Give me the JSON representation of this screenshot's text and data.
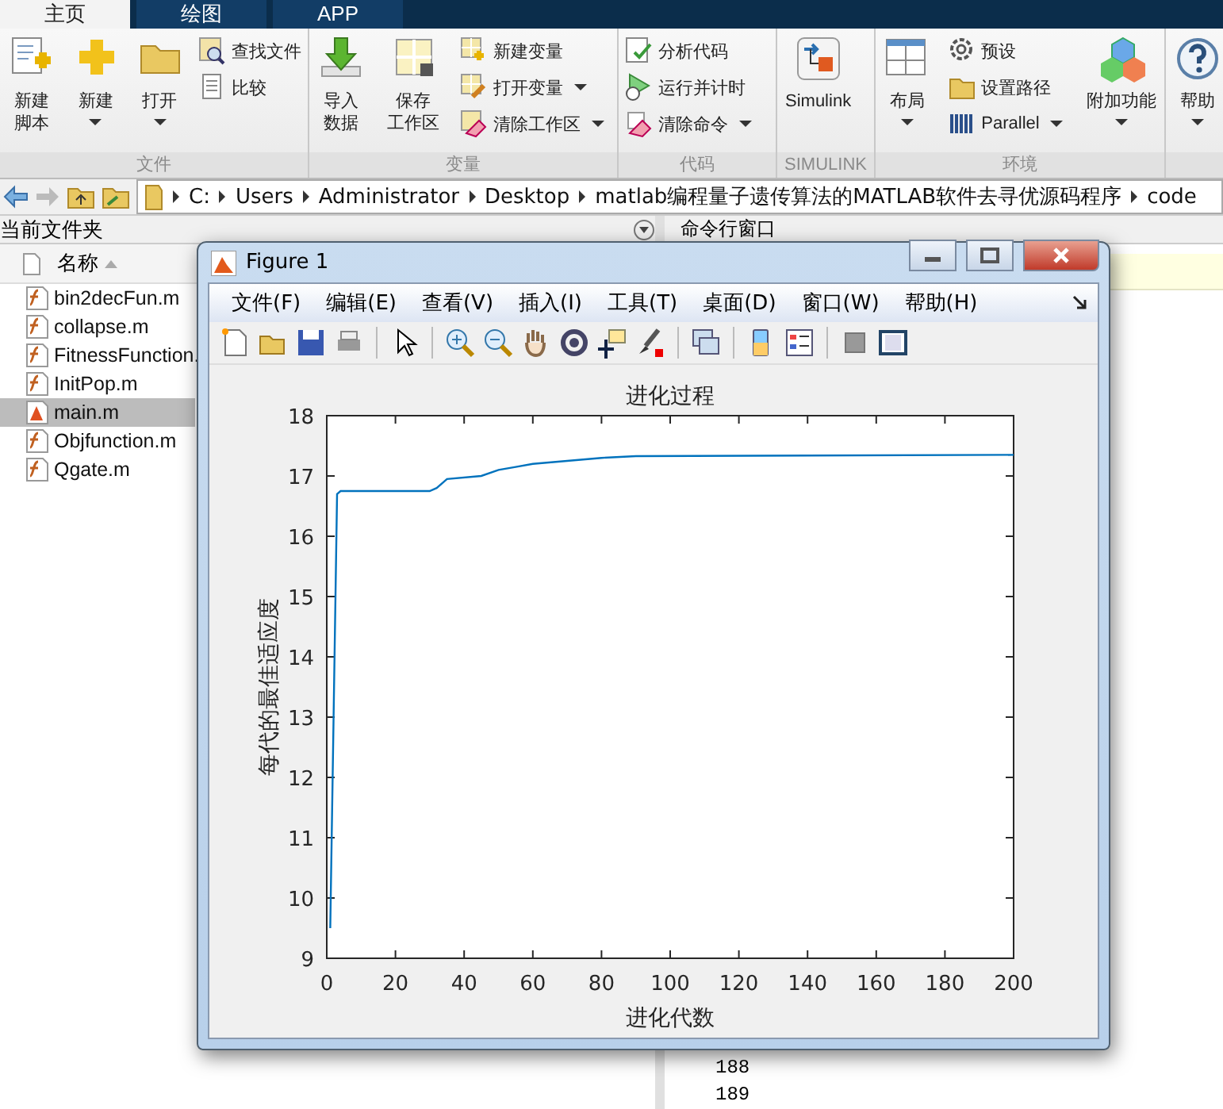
{
  "ribbon": {
    "tabs": [
      {
        "label": "主页",
        "selected": true
      },
      {
        "label": "绘图",
        "selected": false
      },
      {
        "label": "APP",
        "selected": false
      }
    ],
    "groups": [
      {
        "label": "文件",
        "items": [
          {
            "kind": "large",
            "lines": [
              "新建",
              "脚本"
            ],
            "dropdown": false
          },
          {
            "kind": "large",
            "lines": [
              "新建"
            ],
            "dropdown": true
          },
          {
            "kind": "large",
            "lines": [
              "打开"
            ],
            "dropdown": true
          },
          {
            "kind": "small",
            "label": "查找文件",
            "dropdown": false
          },
          {
            "kind": "small",
            "label": "比较",
            "dropdown": false
          }
        ]
      },
      {
        "label": "变量",
        "items": [
          {
            "kind": "large",
            "lines": [
              "导入",
              "数据"
            ],
            "dropdown": false
          },
          {
            "kind": "large",
            "lines": [
              "保存",
              "工作区"
            ],
            "dropdown": false
          },
          {
            "kind": "small",
            "label": "新建变量",
            "dropdown": false
          },
          {
            "kind": "small",
            "label": "打开变量",
            "dropdown": true
          },
          {
            "kind": "small",
            "label": "清除工作区",
            "dropdown": true
          }
        ]
      },
      {
        "label": "代码",
        "items": [
          {
            "kind": "small",
            "label": "分析代码",
            "dropdown": false
          },
          {
            "kind": "small",
            "label": "运行并计时",
            "dropdown": false
          },
          {
            "kind": "small",
            "label": "清除命令",
            "dropdown": true
          }
        ]
      },
      {
        "label": "SIMULINK",
        "items": [
          {
            "kind": "large",
            "lines": [
              "Simulink"
            ],
            "dropdown": false
          }
        ]
      },
      {
        "label": "环境",
        "items": [
          {
            "kind": "large",
            "lines": [
              "布局"
            ],
            "dropdown": true
          },
          {
            "kind": "small",
            "label": "预设",
            "dropdown": false
          },
          {
            "kind": "small",
            "label": "设置路径",
            "dropdown": false
          },
          {
            "kind": "small",
            "label": "Parallel",
            "dropdown": true
          },
          {
            "kind": "large",
            "lines": [
              "附加功能"
            ],
            "dropdown": true
          }
        ]
      },
      {
        "items": [
          {
            "kind": "large",
            "lines": [
              "帮助"
            ],
            "dropdown": true
          }
        ]
      }
    ]
  },
  "address_bar": {
    "path": [
      "C:",
      "Users",
      "Administrator",
      "Desktop",
      "matlab编程量子遗传算法的MATLAB软件去寻优源码程序",
      "code"
    ]
  },
  "current_folder": {
    "title": "当前文件夹",
    "column": "名称",
    "files": [
      {
        "name": "bin2decFun.m",
        "kind": "function",
        "selected": false
      },
      {
        "name": "collapse.m",
        "kind": "function",
        "selected": false
      },
      {
        "name": "FitnessFunction.",
        "kind": "function",
        "selected": false
      },
      {
        "name": "InitPop.m",
        "kind": "function",
        "selected": false
      },
      {
        "name": "main.m",
        "kind": "script",
        "selected": true
      },
      {
        "name": "Objfunction.m",
        "kind": "function",
        "selected": false
      },
      {
        "name": "Qgate.m",
        "kind": "function",
        "selected": false
      }
    ]
  },
  "command_window": {
    "title": "命令行窗口",
    "lines": [
      "188",
      "189"
    ]
  },
  "figure": {
    "title": "Figure 1",
    "menus": [
      "文件(F)",
      "编辑(E)",
      "查看(V)",
      "插入(I)",
      "工具(T)",
      "桌面(D)",
      "窗口(W)",
      "帮助(H)"
    ],
    "chart_data": {
      "type": "line",
      "title": "进化过程",
      "xlabel": "进化代数",
      "ylabel": "每代的最佳适应度",
      "xlim": [
        0,
        200
      ],
      "ylim": [
        9,
        18
      ],
      "xticks": [
        0,
        20,
        40,
        60,
        80,
        100,
        120,
        140,
        160,
        180,
        200
      ],
      "yticks": [
        9,
        10,
        11,
        12,
        13,
        14,
        15,
        16,
        17,
        18
      ],
      "x": [
        1,
        2,
        3,
        4,
        30,
        32,
        35,
        45,
        50,
        55,
        60,
        70,
        80,
        90,
        200
      ],
      "series": [
        {
          "color": "#0072bd",
          "values": [
            9.5,
            13,
            16.7,
            16.75,
            16.75,
            16.8,
            16.95,
            17.0,
            17.1,
            17.15,
            17.2,
            17.25,
            17.3,
            17.33,
            17.35
          ]
        }
      ]
    }
  }
}
